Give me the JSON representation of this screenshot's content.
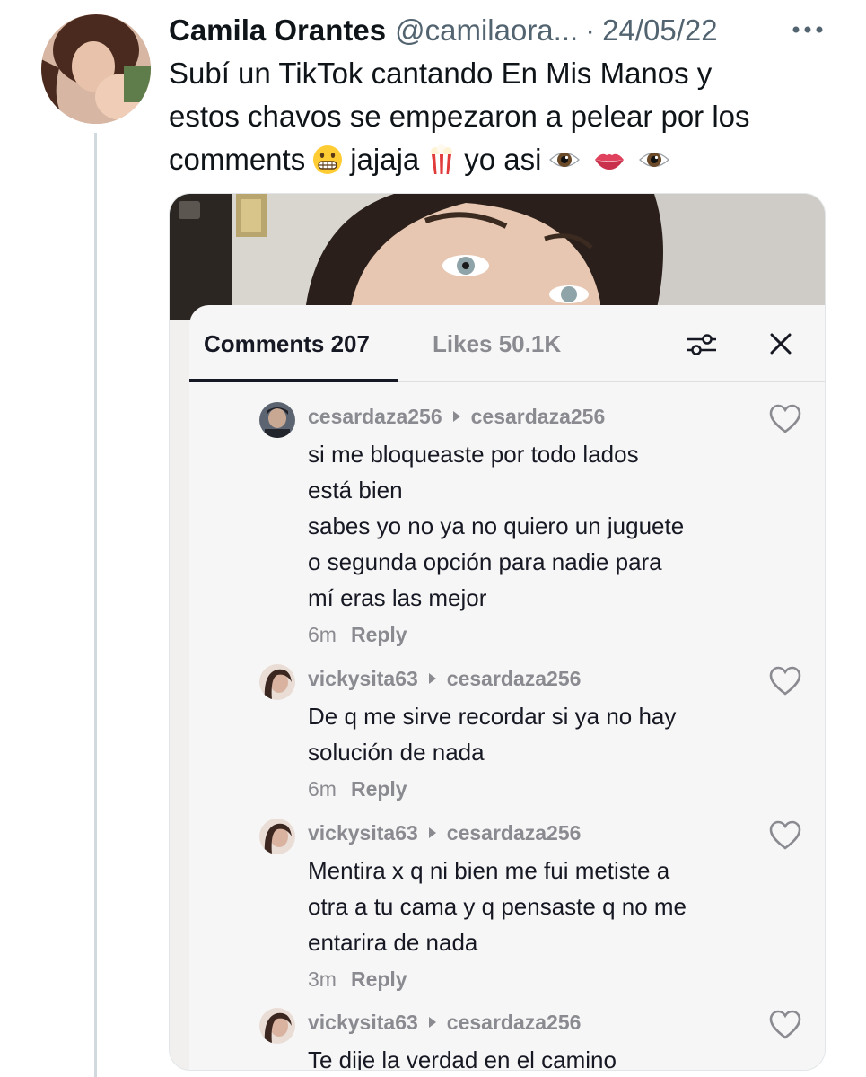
{
  "tweet": {
    "author_name": "Camila Orantes",
    "author_handle": "@camilaora...",
    "separator": "·",
    "date": "24/05/22",
    "text_line1": "Subí un TikTok cantando En Mis Manos y",
    "text_line2": "estos chavos se empezaron a pelear por los",
    "text_line3_a": "comments",
    "text_line3_b": "jajaja",
    "text_line3_c": "yo asi",
    "emojis": [
      "grimacing-face-emoji",
      "popcorn-emoji",
      "eye-emoji",
      "lips-emoji",
      "eye-emoji"
    ]
  },
  "tiktok": {
    "tab_comments": "Comments 207",
    "tab_likes": "Likes 50.1K",
    "comments": [
      {
        "user": "cesardaza256",
        "reply_to": "cesardaza256",
        "lines": [
          "si me bloqueaste por todo lados",
          "está bien",
          "sabes yo no ya no quiero un juguete",
          "o segunda opción para nadie para",
          "mí eras las mejor"
        ],
        "time": "6m",
        "reply_label": "Reply"
      },
      {
        "user": "vickysita63",
        "reply_to": "cesardaza256",
        "lines": [
          "De q me sirve recordar si ya no hay",
          "solución de nada"
        ],
        "time": "6m",
        "reply_label": "Reply"
      },
      {
        "user": "vickysita63",
        "reply_to": "cesardaza256",
        "lines": [
          "Mentira x q ni bien me fui metiste a",
          "otra a tu cama y q pensaste q no me",
          "entarira de nada"
        ],
        "time": "3m",
        "reply_label": "Reply"
      },
      {
        "user": "vickysita63",
        "reply_to": "cesardaza256",
        "lines": [
          "Te dije la verdad en el camino"
        ]
      }
    ]
  },
  "colors": {
    "text_primary": "#0f1419",
    "text_secondary": "#536471",
    "tiktok_text": "#161823",
    "tiktok_muted": "#8a8b91",
    "panel_bg": "#f7f6f6",
    "thread_line": "#cfd9de"
  }
}
